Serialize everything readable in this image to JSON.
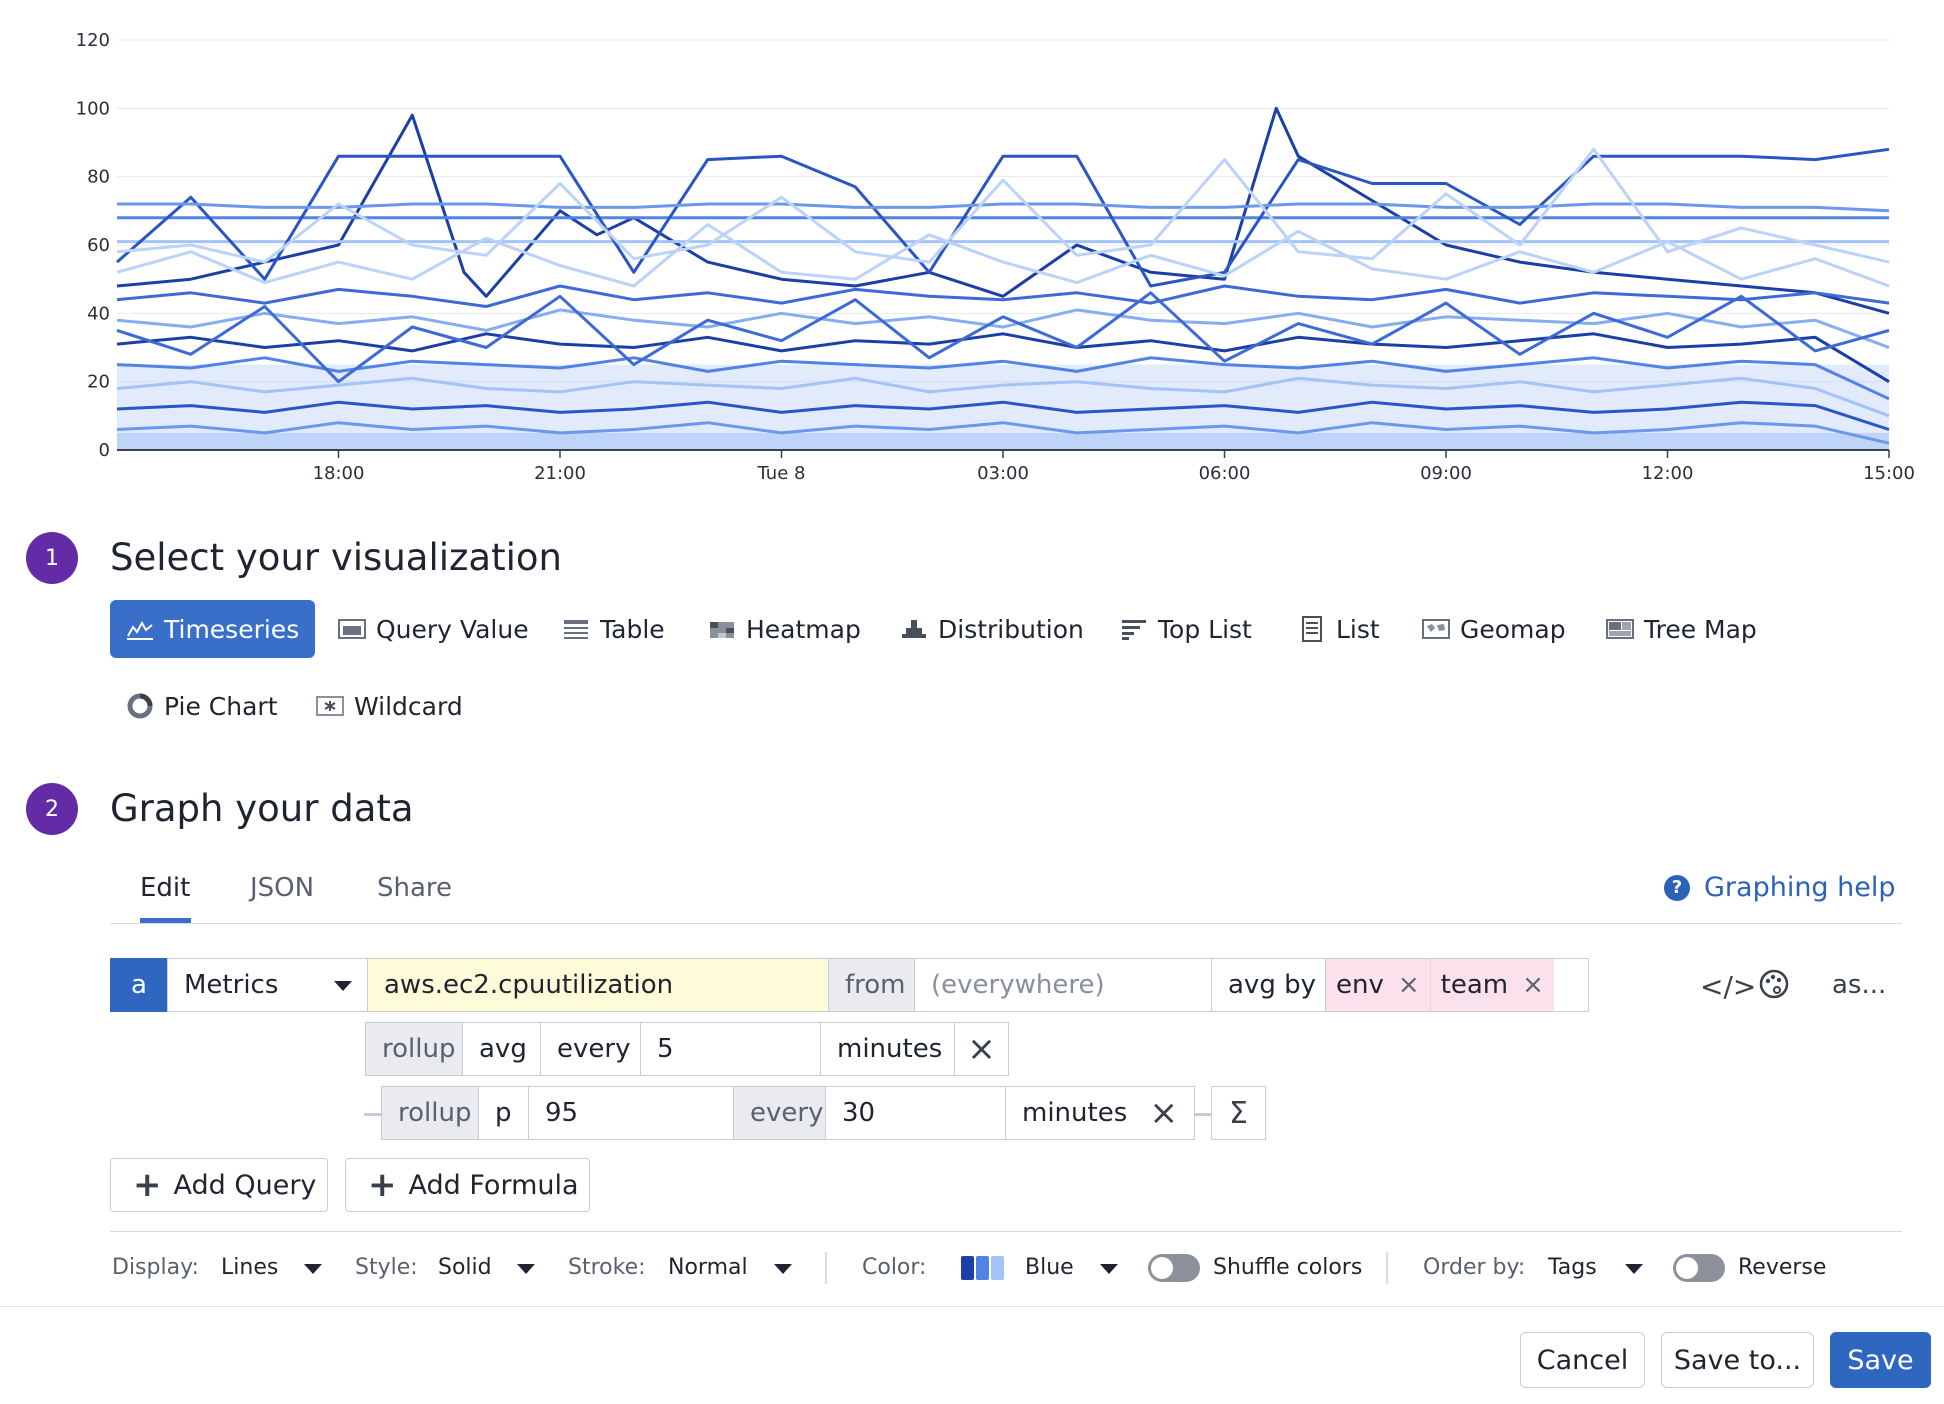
{
  "chart_data": {
    "type": "line",
    "y_ticks": [
      "0",
      "20",
      "40",
      "60",
      "80",
      "100",
      "120"
    ],
    "x_ticks": [
      "18:00",
      "21:00",
      "Tue 8",
      "03:00",
      "06:00",
      "09:00",
      "12:00",
      "15:00"
    ],
    "ylim": [
      0,
      120
    ],
    "x_range_hours": [
      -3,
      21
    ],
    "grid": true,
    "palette": [
      "#1c3fa6",
      "#2a55c4",
      "#3d6ad6",
      "#5282e3",
      "#6b98ec",
      "#86adf2",
      "#a3c2f6",
      "#bcd3f8"
    ],
    "series": [
      {
        "x": [
          -3,
          -2,
          -1,
          0,
          1,
          1.7,
          2,
          3,
          3.5,
          4,
          5,
          6,
          7,
          8,
          9,
          10,
          11,
          12,
          12.7,
          13,
          14,
          15,
          16,
          17,
          18,
          19,
          20,
          21
        ],
        "y": [
          48,
          50,
          55,
          60,
          98,
          52,
          45,
          70,
          63,
          68,
          55,
          50,
          48,
          52,
          45,
          60,
          52,
          50,
          100,
          86,
          73,
          60,
          55,
          52,
          50,
          48,
          46,
          40
        ]
      },
      {
        "x": [
          -3,
          0,
          3,
          6,
          9,
          12,
          15,
          18,
          21
        ],
        "y": [
          68,
          68,
          68,
          68,
          68,
          68,
          68,
          68,
          68
        ]
      },
      {
        "x": [
          -3,
          0,
          3,
          6,
          9,
          12,
          15,
          18,
          21
        ],
        "y": [
          61,
          61,
          61,
          61,
          61,
          61,
          61,
          61,
          61
        ]
      },
      {
        "x": [
          -3,
          -2,
          -1,
          0,
          1,
          2,
          3,
          4,
          5,
          6,
          7,
          8,
          9,
          10,
          11,
          12,
          13,
          14,
          15,
          16,
          17,
          18,
          19,
          20,
          21
        ],
        "y": [
          55,
          74,
          50,
          86,
          86,
          86,
          86,
          52,
          85,
          86,
          77,
          52,
          86,
          86,
          48,
          52,
          85,
          78,
          78,
          66,
          86,
          86,
          86,
          85,
          88
        ]
      },
      {
        "x": [
          -3,
          -2,
          -1,
          0,
          1,
          2,
          3,
          4,
          5,
          6,
          7,
          8,
          9,
          10,
          11,
          12,
          13,
          14,
          15,
          16,
          17,
          18,
          19,
          20,
          21
        ],
        "y": [
          72,
          72,
          71,
          71,
          72,
          72,
          71,
          71,
          72,
          72,
          71,
          71,
          72,
          72,
          71,
          71,
          72,
          72,
          71,
          71,
          72,
          72,
          71,
          71,
          70
        ]
      },
      {
        "x": [
          -3,
          -2,
          -1,
          0,
          1,
          2,
          3,
          4,
          5,
          6,
          7,
          8,
          9,
          10,
          11,
          12,
          13,
          14,
          15,
          16,
          17,
          18,
          19,
          20,
          21
        ],
        "y": [
          52,
          58,
          49,
          55,
          50,
          62,
          54,
          48,
          66,
          52,
          50,
          63,
          55,
          49,
          57,
          51,
          64,
          53,
          50,
          58,
          52,
          61,
          50,
          56,
          48
        ]
      },
      {
        "x": [
          -3,
          -2,
          -1,
          0,
          1,
          2,
          3,
          4,
          5,
          6,
          7,
          8,
          9,
          10,
          11,
          12,
          13,
          14,
          15,
          16,
          17,
          18,
          19,
          20,
          21
        ],
        "y": [
          44,
          46,
          43,
          47,
          45,
          42,
          48,
          44,
          46,
          43,
          47,
          45,
          44,
          46,
          43,
          48,
          45,
          44,
          47,
          43,
          46,
          45,
          44,
          46,
          43
        ]
      },
      {
        "x": [
          -3,
          -2,
          -1,
          0,
          1,
          2,
          3,
          4,
          5,
          6,
          7,
          8,
          9,
          10,
          11,
          12,
          13,
          14,
          15,
          16,
          17,
          18,
          19,
          20,
          21
        ],
        "y": [
          38,
          36,
          40,
          37,
          39,
          35,
          41,
          38,
          36,
          40,
          37,
          39,
          36,
          41,
          38,
          37,
          40,
          36,
          39,
          38,
          37,
          40,
          36,
          38,
          30
        ]
      },
      {
        "x": [
          -3,
          -2,
          -1,
          0,
          1,
          2,
          3,
          4,
          5,
          6,
          7,
          8,
          9,
          10,
          11,
          12,
          13,
          14,
          15,
          16,
          17,
          18,
          19,
          20,
          21
        ],
        "y": [
          31,
          33,
          30,
          32,
          29,
          34,
          31,
          30,
          33,
          29,
          32,
          31,
          34,
          30,
          32,
          29,
          33,
          31,
          30,
          32,
          34,
          30,
          31,
          33,
          20
        ]
      },
      {
        "x": [
          -3,
          -2,
          -1,
          0,
          1,
          2,
          3,
          4,
          5,
          6,
          7,
          8,
          9,
          10,
          11,
          12,
          13,
          14,
          15,
          16,
          17,
          18,
          19,
          20,
          21
        ],
        "y": [
          25,
          24,
          27,
          23,
          26,
          25,
          24,
          27,
          23,
          26,
          25,
          24,
          26,
          23,
          27,
          25,
          24,
          26,
          23,
          25,
          27,
          24,
          26,
          25,
          15
        ]
      },
      {
        "x": [
          -3,
          -2,
          -1,
          0,
          1,
          2,
          3,
          4,
          5,
          6,
          7,
          8,
          9,
          10,
          11,
          12,
          13,
          14,
          15,
          16,
          17,
          18,
          19,
          20,
          21
        ],
        "y": [
          18,
          20,
          17,
          19,
          21,
          18,
          17,
          20,
          19,
          18,
          21,
          17,
          19,
          20,
          18,
          17,
          21,
          19,
          18,
          20,
          17,
          19,
          21,
          18,
          10
        ]
      },
      {
        "x": [
          -3,
          -2,
          -1,
          0,
          1,
          2,
          3,
          4,
          5,
          6,
          7,
          8,
          9,
          10,
          11,
          12,
          13,
          14,
          15,
          16,
          17,
          18,
          19,
          20,
          21
        ],
        "y": [
          12,
          13,
          11,
          14,
          12,
          13,
          11,
          12,
          14,
          11,
          13,
          12,
          14,
          11,
          12,
          13,
          11,
          14,
          12,
          13,
          11,
          12,
          14,
          13,
          6
        ]
      },
      {
        "x": [
          -3,
          -2,
          -1,
          0,
          1,
          2,
          3,
          4,
          5,
          6,
          7,
          8,
          9,
          10,
          11,
          12,
          13,
          14,
          15,
          16,
          17,
          18,
          19,
          20,
          21
        ],
        "y": [
          6,
          7,
          5,
          8,
          6,
          7,
          5,
          6,
          8,
          5,
          7,
          6,
          8,
          5,
          6,
          7,
          5,
          8,
          6,
          7,
          5,
          6,
          8,
          7,
          2
        ]
      },
      {
        "x": [
          -3,
          -2,
          -1,
          0,
          1,
          2,
          3,
          4,
          5,
          6,
          7,
          8,
          9,
          10,
          11,
          12,
          13,
          14,
          15,
          16,
          17,
          18,
          19,
          20,
          21
        ],
        "y": [
          58,
          60,
          55,
          72,
          60,
          57,
          78,
          56,
          60,
          74,
          58,
          55,
          79,
          57,
          60,
          85,
          58,
          56,
          75,
          60,
          88,
          58,
          65,
          60,
          55
        ]
      },
      {
        "x": [
          -3,
          -2,
          -1,
          0,
          1,
          2,
          3,
          4,
          5,
          6,
          7,
          8,
          9,
          10,
          11,
          12,
          13,
          14,
          15,
          16,
          17,
          18,
          19,
          20,
          21
        ],
        "y": [
          35,
          28,
          42,
          20,
          36,
          30,
          45,
          25,
          38,
          32,
          44,
          27,
          39,
          30,
          46,
          26,
          37,
          31,
          43,
          28,
          40,
          33,
          45,
          29,
          35
        ]
      }
    ]
  },
  "sections": {
    "visualization": {
      "step": "1",
      "title": "Select your visualization"
    },
    "graph": {
      "step": "2",
      "title": "Graph your data"
    }
  },
  "viz_types": [
    {
      "label": "Timeseries",
      "icon": "timeseries-icon",
      "active": true
    },
    {
      "label": "Query Value",
      "icon": "query-value-icon"
    },
    {
      "label": "Table",
      "icon": "table-icon"
    },
    {
      "label": "Heatmap",
      "icon": "heatmap-icon"
    },
    {
      "label": "Distribution",
      "icon": "distribution-icon"
    },
    {
      "label": "Top List",
      "icon": "top-list-icon"
    },
    {
      "label": "List",
      "icon": "list-icon"
    },
    {
      "label": "Geomap",
      "icon": "geomap-icon"
    },
    {
      "label": "Tree Map",
      "icon": "tree-map-icon"
    },
    {
      "label": "Pie Chart",
      "icon": "pie-chart-icon"
    },
    {
      "label": "Wildcard",
      "icon": "wildcard-icon"
    }
  ],
  "tabs": [
    "Edit",
    "JSON",
    "Share"
  ],
  "graphing_help": "Graphing help",
  "query": {
    "name": "a",
    "source": "Metrics",
    "metric": "aws.ec2.cpuutilization",
    "from_label": "from",
    "from_placeholder": "(everywhere)",
    "agg": "avg by",
    "tags": [
      "env",
      "team"
    ],
    "alias_label": "as..."
  },
  "rollup1": {
    "label": "rollup",
    "method": "avg",
    "every": "every",
    "interval": "5",
    "unit": "minutes"
  },
  "rollup2": {
    "label": "rollup",
    "method": "p",
    "value": "95",
    "every": "every",
    "interval": "30",
    "unit": "minutes"
  },
  "buttons": {
    "add_query": "Add Query",
    "add_formula": "Add Formula"
  },
  "options": {
    "display_label": "Display:",
    "display": "Lines",
    "style_label": "Style:",
    "style": "Solid",
    "stroke_label": "Stroke:",
    "stroke": "Normal",
    "color_label": "Color:",
    "color": "Blue",
    "shuffle": "Shuffle colors",
    "order_label": "Order by:",
    "order": "Tags",
    "reverse": "Reverse"
  },
  "footer": {
    "cancel": "Cancel",
    "save_to": "Save to...",
    "save": "Save"
  }
}
